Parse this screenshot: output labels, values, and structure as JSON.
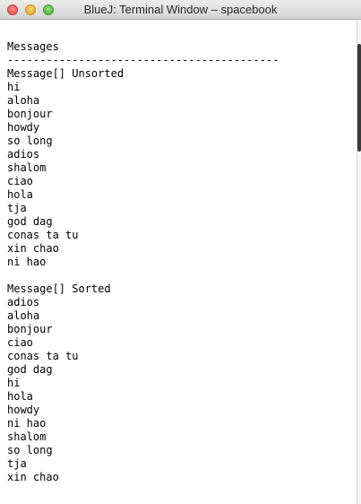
{
  "window": {
    "title": "BlueJ: Terminal Window – spacebook"
  },
  "terminal": {
    "lines": [
      "Messages",
      "------------------------------------------",
      "Message[] Unsorted",
      "hi",
      "aloha",
      "bonjour",
      "howdy",
      "so long",
      "adios",
      "shalom",
      "ciao",
      "hola",
      "tja",
      "god dag",
      "conas ta tu",
      "xin chao",
      "ni hao",
      "",
      "Message[] Sorted",
      "adios",
      "aloha",
      "bonjour",
      "ciao",
      "conas ta tu",
      "god dag",
      "hi",
      "hola",
      "howdy",
      "ni hao",
      "shalom",
      "so long",
      "tja",
      "xin chao"
    ]
  }
}
